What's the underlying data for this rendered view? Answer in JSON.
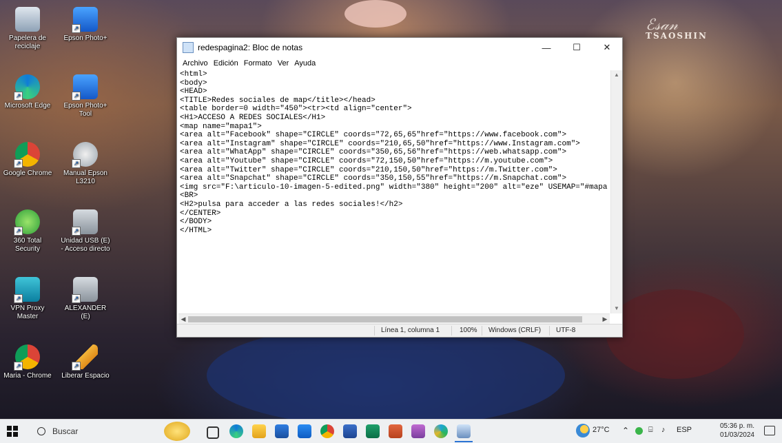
{
  "wallpaper": {
    "signature": "ℰ𝓈𝒶𝓃",
    "brand": "TSAOSHIN"
  },
  "desktop_icons": [
    {
      "label": "Papelera de reciclaje",
      "icon": "recycle-bin-icon"
    },
    {
      "label": "Epson Photo+",
      "icon": "epson-photo-icon"
    },
    {
      "label": "Microsoft Edge",
      "icon": "edge-icon"
    },
    {
      "label": "Epson Photo+ Tool",
      "icon": "epson-photo-tool-icon"
    },
    {
      "label": "Google Chrome",
      "icon": "chrome-icon"
    },
    {
      "label": "Manual Epson L3210",
      "icon": "manual-icon"
    },
    {
      "label": "360 Total Security",
      "icon": "total-security-icon"
    },
    {
      "label": "Unidad USB (E) - Acceso directo",
      "icon": "usb-drive-icon"
    },
    {
      "label": "VPN Proxy Master",
      "icon": "vpn-icon"
    },
    {
      "label": "ALEXANDER (E)",
      "icon": "usb-drive-icon"
    },
    {
      "label": "Maria - Chrome",
      "icon": "chrome-icon"
    },
    {
      "label": "Liberar Espacio",
      "icon": "broom-icon"
    }
  ],
  "notepad": {
    "title": "redespagina2: Bloc de notas",
    "controls": {
      "minimize": "—",
      "maximize": "☐",
      "close": "✕"
    },
    "menu": [
      "Archivo",
      "Edición",
      "Formato",
      "Ver",
      "Ayuda"
    ],
    "lines": [
      "<html>",
      "<body>",
      "<HEAD>",
      "<TITLE>Redes sociales de map</title></head>",
      "<table border=0 width=\"450\"><tr><td align=\"center\">",
      "<H1>ACCESO A REDES SOCIALES</H1>",
      "<map name=\"mapa1\">",
      "<area alt=\"Facebook\" shape=\"CIRCLE\" coords=\"72,65,65\"href=\"https://www.facebook.com\">",
      "<area alt=\"Instagram\" shape=\"CIRCLE\" coords=\"210,65,50\"href=\"https://www.Instagram.com\">",
      "<area alt=\"WhatApp\" shape=\"CIRCLE\" coords=\"350,65,56\"href=\"https://web.whatsapp.com\">",
      "<area alt=\"Youtube\" shape=\"CIRCLE\" coords=\"72,150,50\"href=\"https://m.youtube.com\">",
      "<area alt=\"Twitter\" shape=\"CIRCLE\" coords=\"210,150,50\"href=\"https://m.Twitter.com\">",
      "<area alt=\"Snapchat\" shape=\"CIRCLE\" coords=\"350,150,55\"href=\"https://m.Snapchat.com\">",
      "<img src=\"F:\\articulo-10-imagen-5-edited.png\" width=\"380\" height=\"200\" alt=\"eze\" USEMAP=\"#mapa",
      "<BR>",
      "<H2>pulsa para acceder a las redes sociales!</h2>",
      "</CENTER>",
      "</BODY>",
      "</HTML>"
    ],
    "status": {
      "position": "Línea 1, columna 1",
      "zoom": "100%",
      "line_ending": "Windows (CRLF)",
      "encoding": "UTF-8"
    }
  },
  "taskbar": {
    "search_placeholder": "Buscar",
    "pinned": [
      "emoji-icon",
      "task-view-icon",
      "edge-icon",
      "file-explorer-icon",
      "store-icon",
      "mail-icon",
      "chrome-icon",
      "word-icon",
      "publisher-icon",
      "powerpoint-icon",
      "paint-icon",
      "chrome-canary-icon",
      "notepad-icon"
    ],
    "weather": "27°C",
    "language": "ESP",
    "time": "05:36 p. m.",
    "date": "01/03/2024"
  }
}
